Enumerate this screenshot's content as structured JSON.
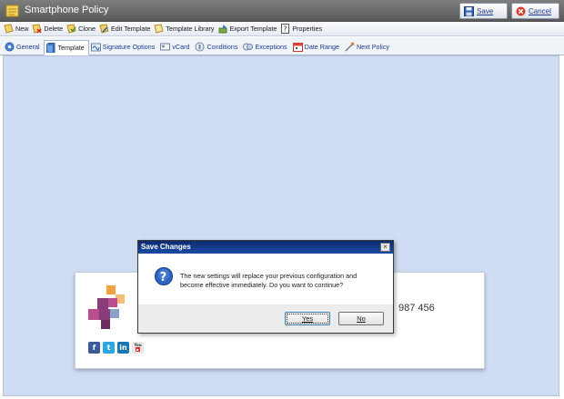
{
  "window": {
    "title": "Smartphone Policy",
    "save_label": "Save",
    "cancel_label": "Cancel"
  },
  "toolbar": {
    "items": [
      {
        "label": "New",
        "icon": "new-icon"
      },
      {
        "label": "Delete",
        "icon": "delete-icon"
      },
      {
        "label": "Clone",
        "icon": "clone-icon"
      },
      {
        "label": "Edit Template",
        "icon": "edit-template-icon"
      },
      {
        "label": "Template Library",
        "icon": "template-library-icon"
      },
      {
        "label": "Export Template",
        "icon": "export-icon"
      },
      {
        "label": "Properties",
        "icon": "properties-icon"
      }
    ]
  },
  "tabs": [
    {
      "label": "General",
      "icon": "general-icon"
    },
    {
      "label": "Template",
      "icon": "template-icon",
      "active": true
    },
    {
      "label": "Signature Options",
      "icon": "signature-options-icon"
    },
    {
      "label": "vCard",
      "icon": "vcard-icon"
    },
    {
      "label": "Conditions",
      "icon": "conditions-icon"
    },
    {
      "label": "Exceptions",
      "icon": "exceptions-icon"
    },
    {
      "label": "Date Range",
      "icon": "calendar-icon"
    },
    {
      "label": "Next Policy",
      "icon": "next-policy-icon"
    }
  ],
  "template_preview": {
    "phone_fragment": "987 456",
    "social": [
      "f",
      "t",
      "in",
      "You"
    ]
  },
  "dialog": {
    "title": "Save Changes",
    "message": "The new settings will replace your previous configuration and become effective immediately. Do you want to continue?",
    "yes_label": "Yes",
    "no_label": "No"
  },
  "colors": {
    "content_background": "#cfdcf3",
    "dialog_title_bar": "#0b2a6e",
    "title_bar": "#6b6b6b"
  }
}
